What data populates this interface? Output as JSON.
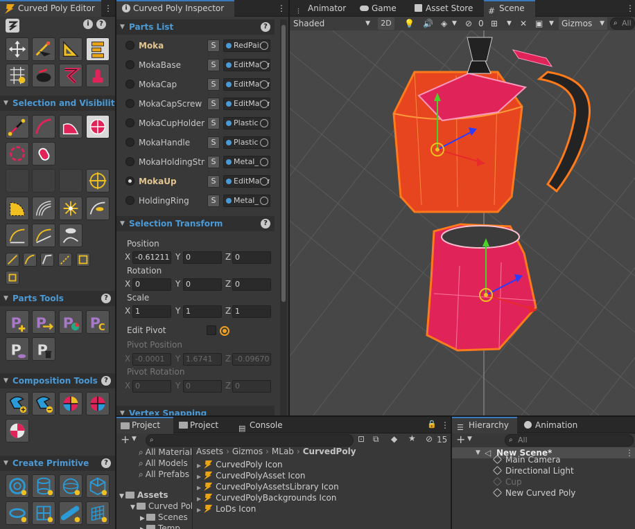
{
  "left_panel": {
    "tab_title": "Curved Poly Editor",
    "sections": {
      "selection": "Selection and Visibility",
      "parts_tools": "Parts Tools",
      "composition": "Composition Tools",
      "create_primitive": "Create Primitive"
    }
  },
  "inspector": {
    "tab_title": "Curved Poly Inspector",
    "parts_list_title": "Parts List",
    "s_label": "S",
    "parts": [
      {
        "name": "Moka",
        "material": "RedPaint",
        "highlighted": true,
        "selected": false
      },
      {
        "name": "MokaBase",
        "material": "EditMaterial",
        "highlighted": false,
        "selected": false
      },
      {
        "name": "MokaCap",
        "material": "EditMaterial",
        "highlighted": false,
        "selected": false
      },
      {
        "name": "MokaCapScrew",
        "material": "EditMaterial",
        "highlighted": false,
        "selected": false
      },
      {
        "name": "MokaCupHolder",
        "material": "Plastic",
        "highlighted": false,
        "selected": false
      },
      {
        "name": "MokaHandle",
        "material": "Plastic",
        "highlighted": false,
        "selected": false
      },
      {
        "name": "MokaHoldingStructure",
        "material": "Metal_",
        "highlighted": false,
        "selected": false
      },
      {
        "name": "MokaUp",
        "material": "EditMaterial",
        "highlighted": true,
        "selected": true
      },
      {
        "name": "HoldingRing",
        "material": "Metal_",
        "highlighted": false,
        "selected": false
      }
    ],
    "transform": {
      "title": "Selection Transform",
      "position_label": "Position",
      "rotation_label": "Rotation",
      "scale_label": "Scale",
      "position": {
        "x": "-0.61211",
        "y": "0",
        "z": "0"
      },
      "rotation": {
        "x": "0",
        "y": "0",
        "z": "0"
      },
      "scale": {
        "x": "1",
        "y": "1",
        "z": "1"
      },
      "edit_pivot_label": "Edit Pivot",
      "pivot_position_label": "Pivot Position",
      "pivot_position": {
        "x": "-0.0001",
        "y": "1.6741",
        "z": "-0.09670"
      },
      "pivot_rotation_label": "Pivot Rotation",
      "pivot_rotation": {
        "x": "0",
        "y": "0",
        "z": "0"
      }
    },
    "vertex_section": "Vertex Snapping",
    "axis": {
      "x": "X",
      "y": "Y",
      "z": "Z"
    }
  },
  "scene": {
    "tabs": [
      "Animator",
      "Game",
      "Asset Store",
      "Scene"
    ],
    "shading_mode": "Shaded",
    "mode_2d": "2D",
    "hidden_count": "0",
    "gizmos_label": "Gizmos",
    "search_placeholder": "All"
  },
  "project": {
    "tabs": [
      "Project",
      "Project",
      "Console"
    ],
    "hidden_count": "15",
    "favorites": [
      "All Materials",
      "All Models",
      "All Prefabs"
    ],
    "tree": [
      "Assets",
      "Curved Poly",
      "Scenes",
      "Temp"
    ],
    "breadcrumb": [
      "Assets",
      "Gizmos",
      "MLab",
      "CurvedPoly"
    ],
    "files": [
      "CurvedPoly Icon",
      "CurvedPolyAsset Icon",
      "CurvedPolyAssetsLibrary Icon",
      "CurvedPolyBackgrounds Icon",
      "LoDs Icon"
    ]
  },
  "hierarchy": {
    "tabs": [
      "Hierarchy",
      "Animation"
    ],
    "search_placeholder": "All",
    "scene_name": "New Scene*",
    "objects": [
      {
        "name": "Main Camera",
        "disabled": false
      },
      {
        "name": "Directional Light",
        "disabled": false
      },
      {
        "name": "Cup",
        "disabled": true
      },
      {
        "name": "New Curved Poly",
        "disabled": false
      }
    ]
  },
  "colors": {
    "accent": "#3a79bb",
    "section_title": "#4b9ad6",
    "highlight": "#e2c58f",
    "model_red": "#e0245a",
    "model_orange": "#ff7a1a"
  }
}
